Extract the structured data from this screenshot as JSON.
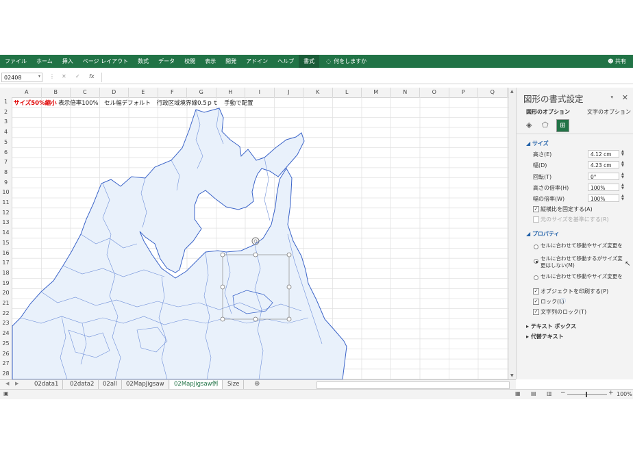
{
  "ribbon": {
    "tabs": [
      "ファイル",
      "ホーム",
      "挿入",
      "ページ レイアウト",
      "数式",
      "データ",
      "校閲",
      "表示",
      "開発",
      "アドイン",
      "ヘルプ",
      "書式"
    ],
    "active_tab": "書式",
    "tell_me": "何をしますか",
    "share": "共有"
  },
  "formula_bar": {
    "name_box": "02408",
    "fx": "fx",
    "value": ""
  },
  "columns": [
    "A",
    "B",
    "C",
    "D",
    "E",
    "F",
    "G",
    "H",
    "I",
    "J",
    "K",
    "L",
    "M",
    "N",
    "O",
    "P",
    "Q"
  ],
  "rows": [
    "1",
    "2",
    "3",
    "4",
    "5",
    "6",
    "7",
    "8",
    "9",
    "10",
    "11",
    "12",
    "13",
    "14",
    "15",
    "16",
    "17",
    "18",
    "19",
    "20",
    "21",
    "22",
    "23",
    "24",
    "25",
    "26",
    "27",
    "28"
  ],
  "cell_a1": {
    "red": "サイズ50%縮小",
    "rest": "表示倍率100%　セル幅デフォルト　行政区域境界線0.5ｐｔ　手動で配置"
  },
  "sheet_tabs": [
    "02data1",
    "02data2",
    "02all",
    "02MapJigsaw",
    "02MapJigsaw例",
    "Size"
  ],
  "active_sheet": "02MapJigsaw例",
  "status": {
    "zoom": "100%",
    "minus": "−",
    "plus": "+"
  },
  "pane": {
    "title": "図形の書式設定",
    "tab_shape": "図形のオプション",
    "tab_text": "文字のオプション",
    "size_section": "サイズ",
    "height_label": "高さ(E)",
    "height_value": "4.12 cm",
    "width_label": "幅(D)",
    "width_value": "4.23 cm",
    "rotation_label": "回転(T)",
    "rotation_value": "0°",
    "scale_h_label": "高さの倍率(H)",
    "scale_h_value": "100%",
    "scale_w_label": "幅の倍率(W)",
    "scale_w_value": "100%",
    "lock_aspect": "縦横比を固定する(A)",
    "relative_original": "元のサイズを基準にする(R)",
    "properties_section": "プロパティ",
    "radio1": "セルに合わせて移動やサイズ変更をする",
    "radio2": "セルに合わせて移動するがサイズ変更はしない(M)",
    "radio3": "セルに合わせて移動やサイズ変更をしない",
    "print_object": "オブジェクトを印刷する(P)",
    "locked": "ロック(L)",
    "lock_text": "文字列のロック(T)",
    "textbox_section": "テキスト ボックス",
    "alt_text_section": "代替テキスト"
  },
  "colors": {
    "ribbon": "#217346",
    "map_fill": "#e9f1fb",
    "map_border": "#3a63c8",
    "red": "#e00000"
  }
}
